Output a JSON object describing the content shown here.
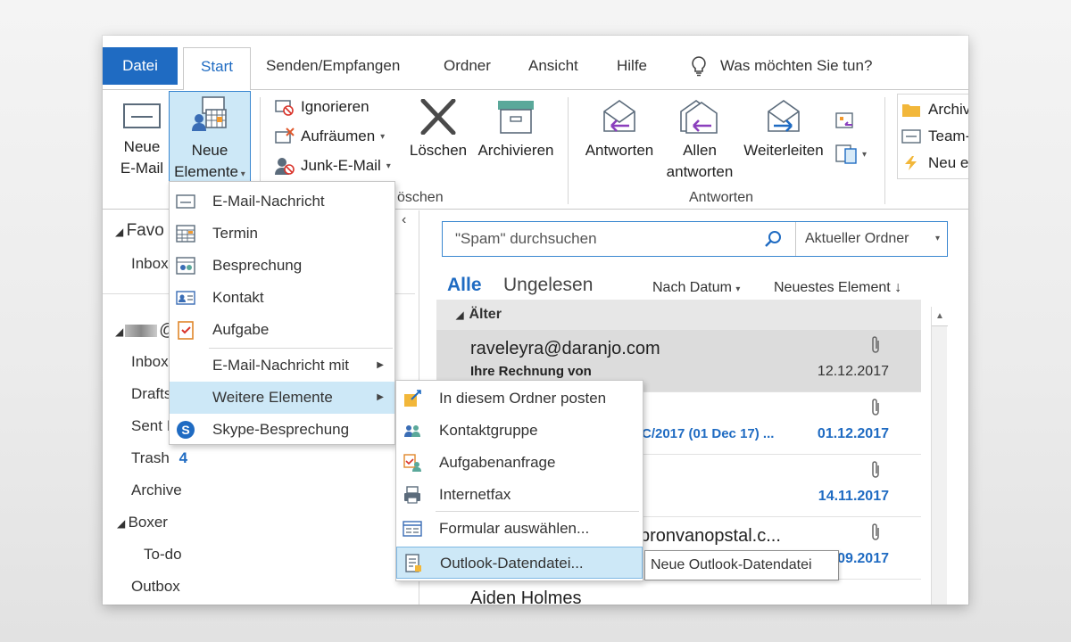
{
  "tabs": {
    "file": "Datei",
    "start": "Start",
    "send_receive": "Senden/Empfangen",
    "folder": "Ordner",
    "view": "Ansicht",
    "help": "Hilfe",
    "tell_me": "Was möchten Sie tun?"
  },
  "ribbon": {
    "new_email": [
      "Neue",
      "E-Mail"
    ],
    "new_items": [
      "Neue",
      "Elemente"
    ],
    "ignore": "Ignorieren",
    "cleanup": "Aufräumen",
    "junk": "Junk-E-Mail",
    "delete_label": "Löschen",
    "archive_label": "Archivieren",
    "delete_group_label": "öschen",
    "reply": "Antworten",
    "reply_all": [
      "Allen",
      "antworten"
    ],
    "forward": "Weiterleiten",
    "respond_group_label": "Antworten",
    "quick_steps": [
      "Archiv",
      "Team-",
      "Neu e"
    ]
  },
  "nav": {
    "favorites": "Favo",
    "inbox_fav": "Inbox",
    "account": "@",
    "items": [
      "Inbox",
      "Drafts",
      "Sent I",
      "Trash",
      "Archive",
      "Boxer",
      "To-do",
      "Outbox"
    ],
    "trash_count": "4"
  },
  "list": {
    "search_placeholder": "\"Spam\" durchsuchen",
    "scope": "Aktueller Ordner",
    "filter_all": "Alle",
    "filter_unread": "Ungelesen",
    "sort_by": "Nach Datum",
    "order": "Neuestes Element",
    "group": "Älter",
    "messages": [
      {
        "from": "raveleyra@daranjo.com",
        "subject": "Ihre Rechnung von",
        "date": "12.12.2017",
        "selected": true
      },
      {
        "from": "",
        "subject": "C/2017 (01 Dec 17) ...",
        "date": "01.12.2017"
      },
      {
        "from": "",
        "subject": "",
        "date": "14.11.2017"
      },
      {
        "from": "pronvanopstal.c...",
        "subject": "",
        "date": "09.2017"
      },
      {
        "from": "Aiden Holmes",
        "subject": "",
        "date": ""
      }
    ]
  },
  "menu_new_items": [
    {
      "label": "E-Mail-Nachricht",
      "icon": "email-icon"
    },
    {
      "label": "Termin",
      "icon": "calendar-icon"
    },
    {
      "label": "Besprechung",
      "icon": "meeting-icon"
    },
    {
      "label": "Kontakt",
      "icon": "contact-card-icon"
    },
    {
      "label": "Aufgabe",
      "icon": "task-icon"
    },
    {
      "label": "E-Mail-Nachricht mit",
      "icon": ""
    },
    {
      "label": "Weitere Elemente",
      "icon": ""
    },
    {
      "label": "Skype-Besprechung",
      "icon": "skype-icon"
    }
  ],
  "menu_more_items": [
    {
      "label": "In diesem Ordner posten",
      "icon": "post-icon"
    },
    {
      "label": "Kontaktgruppe",
      "icon": "contact-group-icon"
    },
    {
      "label": "Aufgabenanfrage",
      "icon": "task-request-icon"
    },
    {
      "label": "Internetfax",
      "icon": "fax-icon"
    },
    {
      "label": "Formular auswählen...",
      "icon": "form-icon"
    },
    {
      "label": "Outlook-Datendatei...",
      "icon": "data-file-icon"
    }
  ],
  "tooltip": "Neue Outlook-Datendatei",
  "colors": {
    "accent": "#1f6bc2",
    "menu_highlight": "#cde8f7"
  }
}
